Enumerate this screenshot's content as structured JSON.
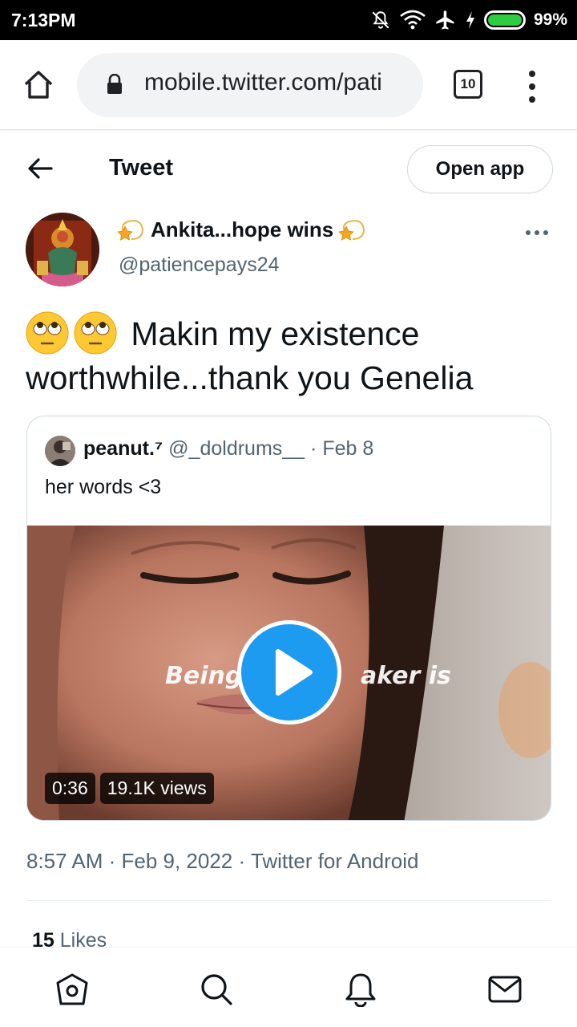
{
  "status_bar": {
    "time": "7:13PM",
    "battery": "99%",
    "icons": [
      "notifications-off-icon",
      "wifi-icon",
      "airplane-icon",
      "charging-icon",
      "battery-icon"
    ]
  },
  "browser": {
    "url": "mobile.twitter.com/pati",
    "tab_count": "10",
    "icons": [
      "home-icon",
      "lock-icon",
      "more-vert-icon"
    ]
  },
  "header": {
    "title": "Tweet",
    "open_app": "Open app"
  },
  "tweet": {
    "author_name": "Ankita...hope wins",
    "author_handle": "@patiencepays24",
    "text": "Makin my existence worthwhile...thank you Genelia",
    "timestamp": "8:57 AM · Feb 9, 2022 · Twitter for Android",
    "likes_count": "15",
    "likes_label": "Likes"
  },
  "quoted_tweet": {
    "name": "peanut.⁷",
    "handle": "@_doldrums__",
    "date": "· Feb 8",
    "text": "her words <3",
    "video_caption_left": "Being",
    "video_caption_right": "aker is",
    "duration": "0:36",
    "views": "19.1K views"
  },
  "bottom_nav": [
    "home-icon",
    "search-icon",
    "notifications-icon",
    "messages-icon"
  ],
  "colors": {
    "accent": "#1d9bf0",
    "secondary_text": "#536471",
    "border": "#cfd9de"
  }
}
